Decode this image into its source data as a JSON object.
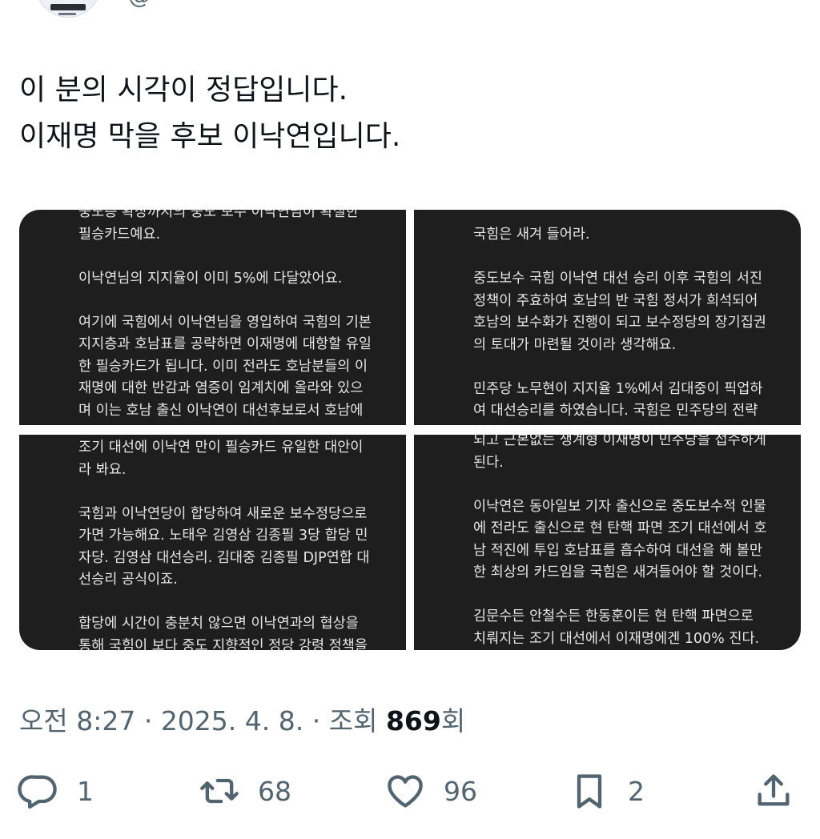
{
  "header": {
    "handle_fragment": "@"
  },
  "tweet": {
    "lines": [
      "이 분의 시각이 정답입니다.",
      "이재명 막을 후보 이낙연입니다."
    ]
  },
  "media": {
    "top_left": [
      "중도층 확장까지의 중도 보수 이낙연님이 확실한",
      "필승카드예요.",
      "",
      "이낙연님의 지지율이 이미 5%에 다달았어요.",
      "",
      "여기에 국힘에서 이낙연님을 영입하여 국힘의 기본",
      "지지층과 호남표를 공략하면 이재명에 대항할 유일",
      "한 필승카드가 됩니다. 이미 전라도 호남분들의 이",
      "재명에 대한 반감과 염증이 임계치에 올라와 있으",
      "며 이는 호남 출신 이낙연이 대선후보로서 호남에"
    ],
    "top_right": [
      "국힘은 새겨 들어라.",
      "",
      "중도보수 국힘 이낙연 대선 승리 이후 국힘의 서진",
      "정책이 주효하여 호남의 반 국힘 정서가 희석되어",
      "호남의 보수화가 진행이 되고 보수정당의 장기집권",
      "의 토대가 마련될 것이라 생각해요.",
      "",
      "민주당 노무현이 지지율 1%에서 김대중이 픽업하",
      "여 대선승리를 하였습니다. 국힘은 민주당의 전략"
    ],
    "bottom_left": [
      "조기 대선에 이낙연 만이 필승카드 유일한 대안이",
      "라 봐요.",
      "",
      "국힘과 이낙연당이 합당하여 새로운 보수정당으로",
      "가면 가능해요. 노태우 김영삼 김종필 3당 합당 민",
      "자당. 김영삼 대선승리. 김대중 김종필 DJP연합 대",
      "선승리 공식이죠.",
      "",
      "합당에 시간이 충분치 않으면 이낙연과의 협상을",
      "통해 국힘이 보다 중도 지향적인 정당 강령 정책을"
    ],
    "bottom_right": [
      "되고 근본없는 생계형 이재명이 민주당을 접수하게",
      "된다.",
      "",
      "이낙연은 동아일보 기자 출신으로 중도보수적 인물",
      "에 전라도 출신으로 현 탄핵 파면 조기 대선에서 호",
      "남 적진에 투입 호남표를 흡수하여 대선을 해 볼만",
      "한 최상의 카드임을 국힘은 새겨들어야 할 것이다.",
      "",
      "김문수든 안철수든 한동훈이든 현 탄핵 파면으로",
      "치뤄지는 조기 대선에서 이재명에겐 100% 진다."
    ]
  },
  "meta": {
    "time": "오전 8:27",
    "sep1": " · ",
    "date": "2025. 4. 8.",
    "sep2": " · ",
    "views_label": "조회 ",
    "views_count": "869",
    "views_suffix": "회"
  },
  "actions": {
    "reply": {
      "icon": "reply-icon",
      "count": "1"
    },
    "retweet": {
      "icon": "retweet-icon",
      "count": "68"
    },
    "like": {
      "icon": "heart-icon",
      "count": "96"
    },
    "bookmark": {
      "icon": "bookmark-icon",
      "count": "2"
    },
    "share": {
      "icon": "share-icon"
    }
  },
  "colors": {
    "text": "#0f1419",
    "secondary": "#536471",
    "panel_bg": "#1e1e1e",
    "panel_text": "#e6e6e6"
  }
}
